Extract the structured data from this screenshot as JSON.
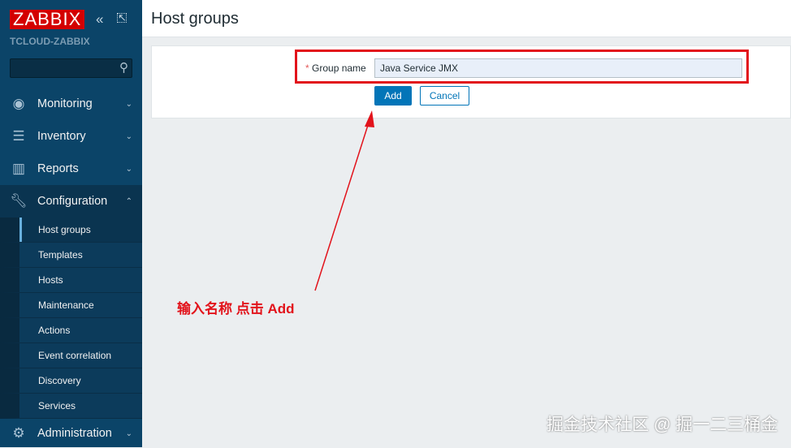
{
  "sidebar": {
    "logo": "ZABBIX",
    "server": "TCLOUD-ZABBIX",
    "search_placeholder": "",
    "menu": [
      {
        "label": "Monitoring"
      },
      {
        "label": "Inventory"
      },
      {
        "label": "Reports"
      },
      {
        "label": "Configuration"
      },
      {
        "label": "Administration"
      }
    ],
    "submenu": [
      "Host groups",
      "Templates",
      "Hosts",
      "Maintenance",
      "Actions",
      "Event correlation",
      "Discovery",
      "Services"
    ]
  },
  "header": {
    "title": "Host groups"
  },
  "form": {
    "required_mark": "*",
    "group_name_label": "Group name",
    "group_name_value": "Java Service JMX",
    "add_label": "Add",
    "cancel_label": "Cancel"
  },
  "annotation": "输入名称 点击 Add",
  "watermark": "掘金技术社区 @ 掘一二三桶金",
  "colors": {
    "sidebar": "#0b4468",
    "accent": "#0275b8",
    "annotation": "#e2131b"
  }
}
